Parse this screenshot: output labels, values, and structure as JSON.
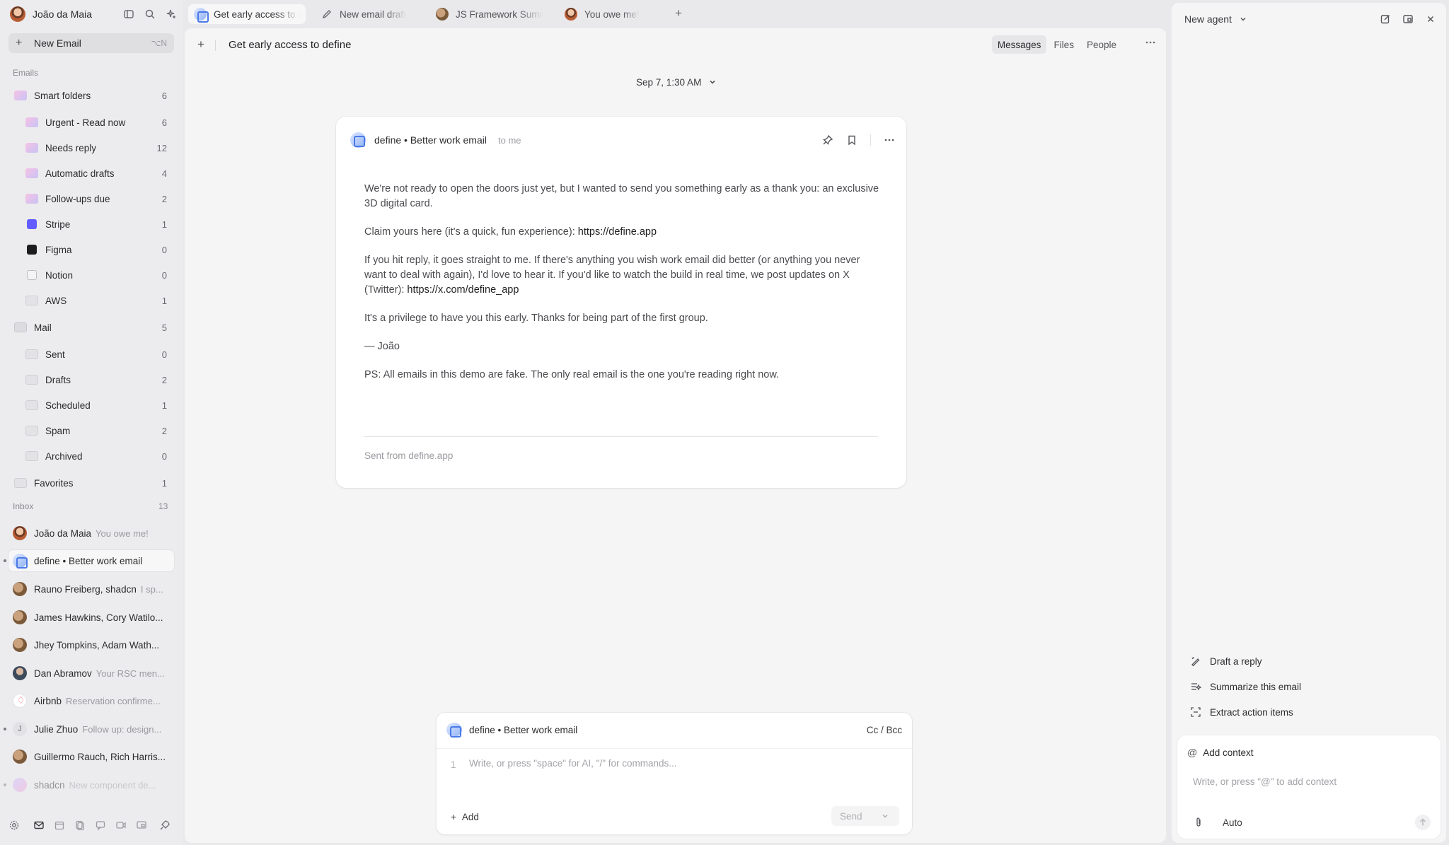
{
  "account": {
    "name": "João da Maia"
  },
  "sidebar": {
    "new_email_label": "New Email",
    "new_email_shortcut": "⌥N",
    "emails_label": "Emails",
    "folders": [
      {
        "label": "Smart folders",
        "count": "6"
      },
      {
        "label": "Urgent - Read now",
        "count": "6"
      },
      {
        "label": "Needs reply",
        "count": "12"
      },
      {
        "label": "Automatic drafts",
        "count": "4"
      },
      {
        "label": "Follow-ups due",
        "count": "2"
      },
      {
        "label": "Stripe",
        "count": "1"
      },
      {
        "label": "Figma",
        "count": "0"
      },
      {
        "label": "Notion",
        "count": "0"
      },
      {
        "label": "AWS",
        "count": "1"
      },
      {
        "label": "Mail",
        "count": "5"
      },
      {
        "label": "Sent",
        "count": "0"
      },
      {
        "label": "Drafts",
        "count": "2"
      },
      {
        "label": "Scheduled",
        "count": "1"
      },
      {
        "label": "Spam",
        "count": "2"
      },
      {
        "label": "Archived",
        "count": "0"
      },
      {
        "label": "Favorites",
        "count": "1"
      }
    ],
    "inbox_label": "Inbox",
    "inbox_count": "13",
    "inbox": [
      {
        "who": "João da Maia",
        "snippet": "You owe me!"
      },
      {
        "who": "define • Better work email",
        "snippet": ""
      },
      {
        "who": "Rauno Freiberg, shadcn",
        "snippet": "I sp..."
      },
      {
        "who": "James Hawkins, Cory Watilo...",
        "snippet": ""
      },
      {
        "who": "Jhey Tompkins, Adam Wath...",
        "snippet": ""
      },
      {
        "who": "Dan Abramov",
        "snippet": "Your RSC men..."
      },
      {
        "who": "Airbnb",
        "snippet": "Reservation confirme..."
      },
      {
        "who": "Julie Zhuo",
        "snippet": "Follow up: design..."
      },
      {
        "who": "Guillermo Rauch, Rich Harris...",
        "snippet": ""
      },
      {
        "who": "shadcn",
        "snippet": "New component de..."
      }
    ]
  },
  "tabs": [
    {
      "label": "Get early access to define"
    },
    {
      "label": "New email draft"
    },
    {
      "label": "JS Framework Summit"
    },
    {
      "label": "You owe me!"
    }
  ],
  "thread": {
    "title": "Get early access to define",
    "view_tabs": [
      "Messages",
      "Files",
      "People"
    ],
    "date": "Sep 7, 1:30 AM"
  },
  "message": {
    "from": "define • Better work email",
    "to": "to me",
    "p1": "We're not ready to open the doors just yet, but I wanted to send you something early as a thank you: an exclusive 3D digital card.",
    "p2_text": "Claim yours here (it's a quick, fun experience): ",
    "p2_link": "https://define.app",
    "p3_text": "If you hit reply, it goes straight to me. If there's anything you wish work email did better (or anything you never want to deal with again), I'd love to hear it. If you'd like to watch the build in real time, we post updates on X (Twitter): ",
    "p3_link": "https://x.com/define_app",
    "p4": "It's a privilege to have you this early. Thanks for being part of the first group.",
    "p5": "— João",
    "p6": "PS: All emails in this demo are fake. The only real email is the one you're reading right now.",
    "signature": "Sent from define.app"
  },
  "composer": {
    "to": "define • Better work email",
    "cc_bcc": "Cc / Bcc",
    "line_number": "1",
    "placeholder": "Write, or press \"space\" for AI, \"/\" for commands...",
    "add_label": "Add",
    "send_label": "Send"
  },
  "agent": {
    "title": "New agent",
    "suggestions": [
      "Draft a reply",
      "Summarize this email",
      "Extract action items"
    ],
    "add_context_label": "Add context",
    "placeholder": "Write, or press \"@\" to add context",
    "mode": "Auto"
  }
}
